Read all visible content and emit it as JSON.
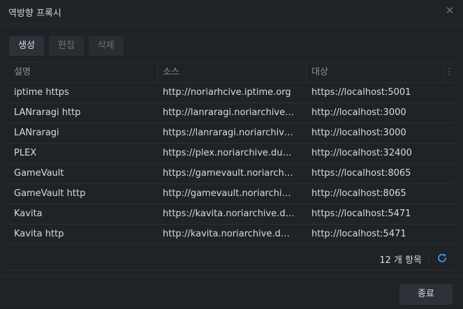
{
  "dialog": {
    "title": "역방향 프록시",
    "close_glyph": "✕"
  },
  "toolbar": {
    "create_label": "생성",
    "edit_label": "편집",
    "delete_label": "삭제"
  },
  "table": {
    "columns": [
      "설명",
      "소스",
      "대상"
    ],
    "menu_glyph": "⋮",
    "rows": [
      {
        "description": "iptime https",
        "source": "http://noriarhcive.iptime.org",
        "target": "https://localhost:5001"
      },
      {
        "description": "LANraragi http",
        "source": "http://lanraragi.noriarchive.duckdns.org",
        "target": "http://localhost:3000"
      },
      {
        "description": "LANraragi",
        "source": "https://lanraragi.noriarchive.duckdns.org",
        "target": "http://localhost:3000"
      },
      {
        "description": "PLEX",
        "source": "https://plex.noriarchive.duckdns.org",
        "target": "http://localhost:32400"
      },
      {
        "description": "GameVault",
        "source": "https://gamevault.noriarchive.duckdns.org",
        "target": "https://localhost:8065"
      },
      {
        "description": "GameVault http",
        "source": "http://gamevault.noriarchive.duckdns.org",
        "target": "http://localhost:8065"
      },
      {
        "description": "Kavita",
        "source": "https://kavita.noriarchive.duckdns.org",
        "target": "https://localhost:5471"
      },
      {
        "description": "Kavita http",
        "source": "http://kavita.noriarchive.duckdns.org",
        "target": "http://localhost:5471"
      }
    ]
  },
  "footer": {
    "count_label": "12 개 항목",
    "refresh_icon": "refresh-icon"
  },
  "actions": {
    "close_label": "종료"
  },
  "colors": {
    "accent": "#3b8fe0"
  }
}
